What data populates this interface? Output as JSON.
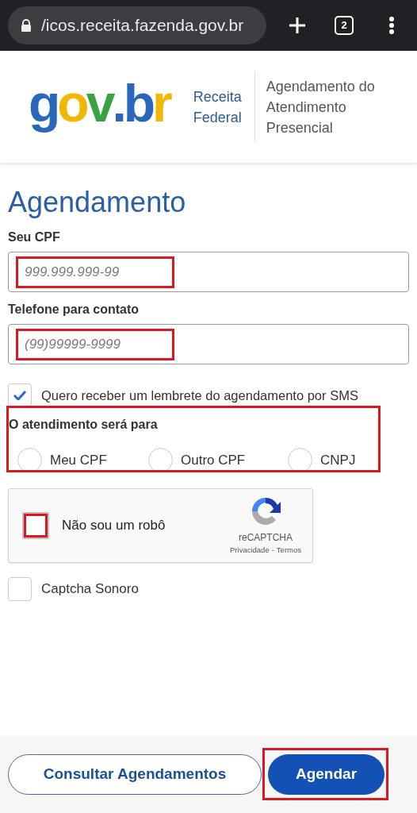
{
  "browser": {
    "url": "/icos.receita.fazenda.gov.br",
    "tab_count": "2"
  },
  "header": {
    "logo": [
      {
        "text": "g",
        "color": "#2b67b8"
      },
      {
        "text": "o",
        "color": "#f2b705"
      },
      {
        "text": "v",
        "color": "#3aa33f"
      },
      {
        "text": ".",
        "color": "#2b67b8"
      },
      {
        "text": "b",
        "color": "#2b67b8"
      },
      {
        "text": "r",
        "color": "#f2b705"
      }
    ],
    "agency": [
      "Receita",
      "Federal"
    ],
    "service": [
      "Agendamento do",
      "Atendimento",
      "Presencial"
    ]
  },
  "title": "Agendamento",
  "fields": [
    {
      "label": "Seu CPF",
      "placeholder": "999.999.999-99",
      "highlight": true
    },
    {
      "label": "Telefone para contato",
      "placeholder": "(99)99999-9999",
      "highlight": true
    }
  ],
  "sms_reminder": {
    "label": "Quero receber um lembrete do agendamento por SMS",
    "checked": true
  },
  "service_for": {
    "label": "O atendimento será para",
    "highlight": true,
    "options": [
      {
        "label": "Meu CPF",
        "selected": false
      },
      {
        "label": "Outro CPF",
        "selected": false
      },
      {
        "label": "CNPJ",
        "selected": false
      }
    ]
  },
  "captcha": {
    "label": "Não sou um robô",
    "checked": false,
    "highlight": true,
    "brand": "reCAPTCHA",
    "links": [
      "Privacidade",
      "Termos"
    ],
    "separator": "-"
  },
  "audio_captcha": {
    "label": "Captcha Sonoro",
    "checked": false
  },
  "buttons": [
    {
      "label": "Consultar Agendamentos",
      "kind": "secondary",
      "highlight": false
    },
    {
      "label": "Agendar",
      "kind": "primary",
      "highlight": true
    }
  ]
}
